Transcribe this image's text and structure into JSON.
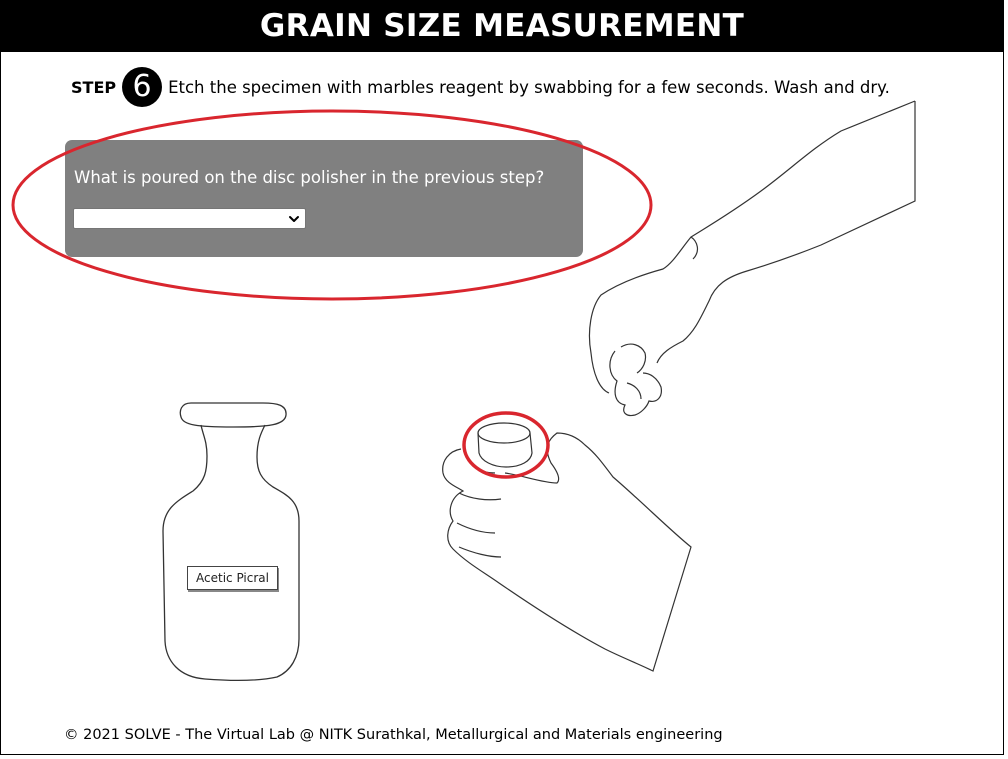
{
  "header": {
    "title": "GRAIN SIZE MEASUREMENT"
  },
  "step": {
    "label": "STEP",
    "number": "6",
    "instruction": "Etch the specimen with marbles reagent by swabbing for a few seconds. Wash and dry."
  },
  "quiz": {
    "question": "What is poured on the disc polisher in the previous step?",
    "selected_value": ""
  },
  "bottle": {
    "label": "Acetic Picral"
  },
  "highlight": {
    "color": "#d9262e"
  },
  "footer": {
    "text": "© 2021 SOLVE - The Virtual Lab @ NITK Surathkal, Metallurgical and Materials engineering"
  },
  "icons": [
    "chevron-down-icon",
    "bottle-illustration",
    "hand-holding-specimen-illustration",
    "hand-with-swab-illustration"
  ]
}
